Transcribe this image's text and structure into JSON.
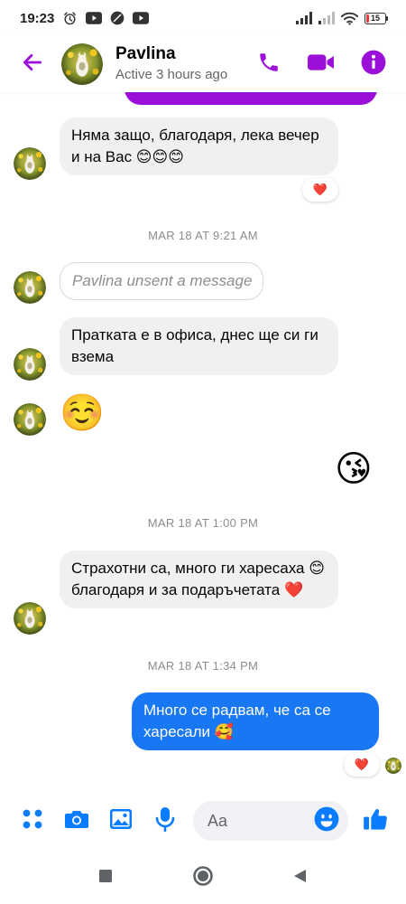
{
  "status_bar": {
    "time": "19:23",
    "battery_level": "15",
    "icons": [
      "alarm-icon",
      "youtube-icon",
      "dnd-icon",
      "youtube-icon",
      "signal-icon",
      "signal-icon",
      "wifi-icon",
      "battery-icon"
    ]
  },
  "header": {
    "contact_name": "Pavlina",
    "status": "Active 3 hours ago",
    "accent_color": "#9b0fd8",
    "icons": [
      "back-arrow-icon",
      "phone-icon",
      "video-camera-icon",
      "info-icon"
    ]
  },
  "messages": [
    {
      "type": "incoming",
      "text": "Няма защо, благодаря, лека вечер и на Вас 😊😊😊",
      "reaction": "❤️"
    },
    {
      "type": "timestamp",
      "text": "MAR 18 AT 9:21 AM"
    },
    {
      "type": "unsent",
      "text": "Pavlina unsent a message"
    },
    {
      "type": "incoming",
      "text": "Пратката е в офиса, днес ще си ги взема"
    },
    {
      "type": "incoming-emoji",
      "text": "☺️"
    },
    {
      "type": "outgoing-emoji",
      "text": "😘"
    },
    {
      "type": "timestamp",
      "text": "MAR 18 AT 1:00 PM"
    },
    {
      "type": "incoming",
      "text": "Страхотни са, много ги харесаха 😊 благодаря и за подаръчетата ❤️"
    },
    {
      "type": "timestamp",
      "text": "MAR 18 AT 1:34 PM"
    },
    {
      "type": "outgoing",
      "text": "Много се радвам, че са се харесали 🥰",
      "reaction": "❤️"
    }
  ],
  "composer": {
    "placeholder": "Aa",
    "icons": [
      "apps-grid-icon",
      "camera-icon",
      "image-icon",
      "microphone-icon",
      "emoji-icon",
      "thumbs-up-icon"
    ]
  },
  "colors": {
    "outgoing_bubble": "#1877f2",
    "incoming_bubble": "#f0f0f0",
    "composer_icons": "#0a7cff"
  },
  "nav_bar": {
    "icons": [
      "recents-square-icon",
      "home-circle-icon",
      "back-triangle-icon"
    ]
  }
}
